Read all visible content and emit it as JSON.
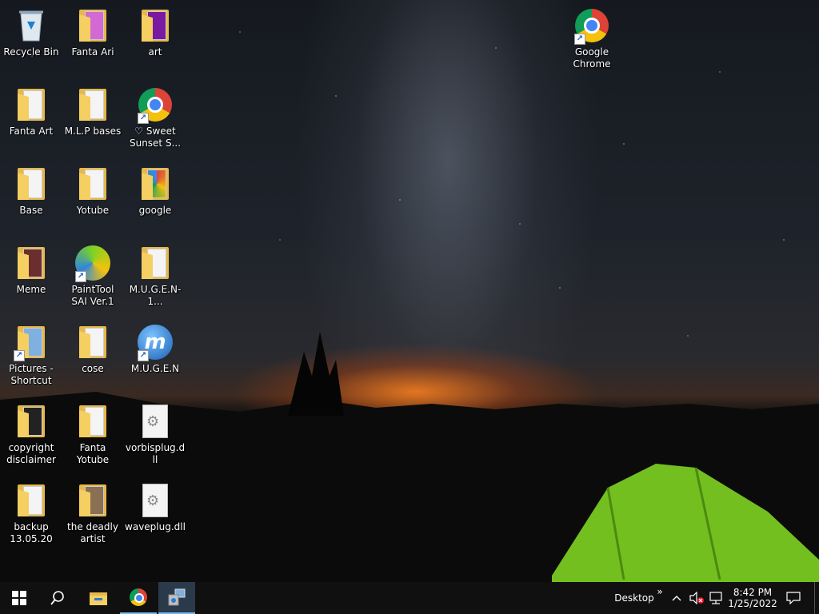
{
  "desktop": {
    "icons": [
      {
        "label": "Recycle Bin",
        "type": "recycle-bin"
      },
      {
        "label": "Fanta Ari",
        "type": "folder"
      },
      {
        "label": "art",
        "type": "folder"
      },
      {
        "label": "Google Chrome",
        "type": "chrome-shortcut"
      },
      {
        "label": "Fanta Art",
        "type": "folder"
      },
      {
        "label": "M.L.P bases",
        "type": "folder"
      },
      {
        "label": "♡ Sweet Sunset S...",
        "type": "chrome-shortcut"
      },
      {
        "label": "Base",
        "type": "folder"
      },
      {
        "label": "Yotube",
        "type": "folder"
      },
      {
        "label": "google",
        "type": "folder"
      },
      {
        "label": "Meme",
        "type": "folder"
      },
      {
        "label": "PaintTool SAI Ver.1",
        "type": "app-shortcut"
      },
      {
        "label": "M.U.G.E.N-1...",
        "type": "folder"
      },
      {
        "label": "Pictures - Shortcut",
        "type": "folder-shortcut"
      },
      {
        "label": "cose",
        "type": "folder"
      },
      {
        "label": "M.U.G.E.N",
        "type": "app-shortcut"
      },
      {
        "label": "copyright disclaimer",
        "type": "file"
      },
      {
        "label": "Fanta Yotube",
        "type": "folder"
      },
      {
        "label": "vorbisplug.dll",
        "type": "dll"
      },
      {
        "label": "backup 13.05.20",
        "type": "folder"
      },
      {
        "label": "the deadly artist",
        "type": "folder"
      },
      {
        "label": "waveplug.dll",
        "type": "dll"
      }
    ]
  },
  "taskbar": {
    "start_icon": "windows-start-icon",
    "search_icon": "search-icon",
    "pinned": [
      {
        "name": "file-explorer-icon"
      },
      {
        "name": "chrome-icon"
      },
      {
        "name": "mugen-app-icon"
      }
    ],
    "desktop_label": "Desktop",
    "chevron": "»",
    "clock_time": "8:42 PM",
    "clock_date": "1/25/2022"
  },
  "colors": {
    "taskbar_bg": "#101010",
    "active_accent": "#76b9ed",
    "folder_yellow": "#f5cf62"
  }
}
